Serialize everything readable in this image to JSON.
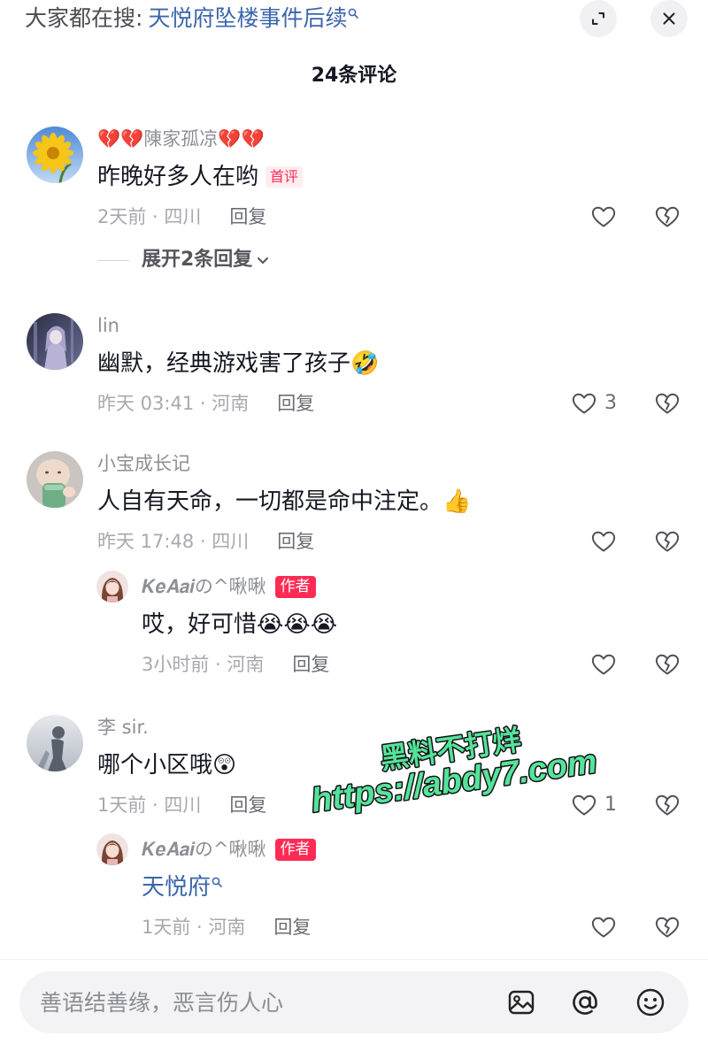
{
  "search_bar": {
    "prefix": "大家都在搜:",
    "query": "天悦府坠楼事件后续",
    "query_icon": "search-icon"
  },
  "window_controls": {
    "collapse_icon": "expand-icon",
    "close_icon": "close-icon"
  },
  "header": {
    "title": "24条评论"
  },
  "comments": [
    {
      "username": "💔💔陳家孤凉💔💔",
      "avatar": "sunflower-avatar",
      "text": "昨晚好多人在哟",
      "badge": "首评",
      "meta": "2天前 · 四川",
      "reply_label": "回复",
      "expand_replies": "展开2条回复"
    },
    {
      "username": "lin",
      "avatar": "anime-avatar",
      "text": "幽默，经典游戏害了孩子🤣",
      "meta": "昨天 03:41 · 河南",
      "reply_label": "回复",
      "likes": "3"
    },
    {
      "username": "小宝成长记",
      "avatar": "baby-avatar",
      "text": "人自有天命，一切都是命中注定。👍",
      "meta": "昨天 17:48 · 四川",
      "reply_label": "回复",
      "replies": [
        {
          "username": "𝑲𝒆𝑨𝒂𝒊の^啾啾",
          "avatar": "girl-avatar",
          "badge": "作者",
          "text": "哎，好可惜😭😭😭",
          "meta": "3小时前 · 河南",
          "reply_label": "回复"
        }
      ]
    },
    {
      "username": "李 sir.",
      "avatar": "shadow-avatar",
      "text": "哪个小区哦😲",
      "meta": "1天前 · 四川",
      "reply_label": "回复",
      "likes": "1",
      "replies": [
        {
          "username": "𝑲𝒆𝑨𝒂𝒊の^啾啾",
          "avatar": "girl-avatar",
          "badge": "作者",
          "text": "天悦府",
          "meta": "1天前 · 河南",
          "reply_label": "回复"
        }
      ]
    }
  ],
  "watermark": {
    "line1": "黑料不打烊",
    "line2": "https://abdy7.com"
  },
  "composer": {
    "placeholder": "善语结善缘，恶言伤人心",
    "icons": [
      "image-icon",
      "at-icon",
      "emoji-icon"
    ]
  },
  "icons": {
    "like": "heart-icon",
    "dislike": "broken-heart-icon",
    "expand_chevron": "chevron-down-icon"
  },
  "colors": {
    "accent_red": "#FE2C55",
    "link_blue": "#3B66AC",
    "text_primary": "#161823",
    "text_secondary": "#8E8F95",
    "watermark_green": "#55E39B"
  }
}
